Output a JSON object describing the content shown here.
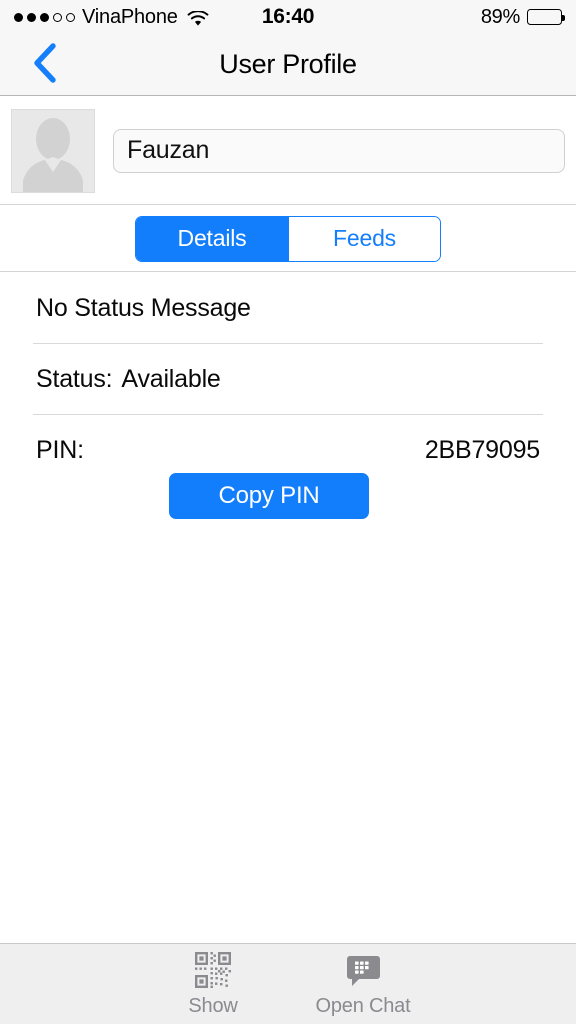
{
  "status_bar": {
    "signal_dots_filled": 3,
    "signal_dots_total": 5,
    "carrier": "VinaPhone",
    "wifi_icon": "wifi-icon",
    "time": "16:40",
    "battery_percent": "89%",
    "battery_level": 89
  },
  "nav": {
    "back_icon": "chevron-left-icon",
    "title": "User Profile"
  },
  "profile": {
    "avatar_icon": "person-placeholder-icon",
    "display_name": "Fauzan",
    "name_placeholder": "Name"
  },
  "segmented_control": {
    "options": [
      {
        "label": "Details",
        "selected": true
      },
      {
        "label": "Feeds",
        "selected": false
      }
    ]
  },
  "details": {
    "status_message": "No Status Message",
    "status_label": "Status:",
    "status_value": "Available",
    "pin_label": "PIN:",
    "pin_value": "2BB79095",
    "copy_pin_label": "Copy PIN"
  },
  "toolbar": {
    "items": [
      {
        "label": "Show",
        "icon": "qr-code-icon"
      },
      {
        "label": "Open Chat",
        "icon": "chat-bubble-icon"
      }
    ]
  },
  "colors": {
    "accent_blue": "#127efb",
    "bar_gray": "#f7f7f7",
    "toolbar_gray": "#efeff0",
    "label_gray": "#8a8a8f"
  }
}
